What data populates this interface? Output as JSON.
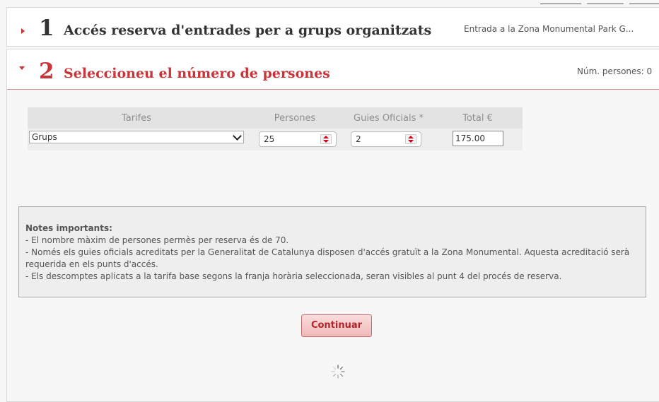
{
  "step1": {
    "number": "1",
    "title": "Accés reserva d'entrades per a grups organitzats",
    "summary": "Entrada a la Zona Monumental Park G..."
  },
  "step2": {
    "number": "2",
    "title": "Seleccioneu el número de persones",
    "summary": "Núm. persones: 0"
  },
  "table": {
    "headers": [
      "Tarifes",
      "Persones",
      "Guies Oficials *",
      "Total €"
    ],
    "rate_selected": "Grups",
    "persons_value": "25",
    "guides_value": "2",
    "total_value": "175.00"
  },
  "notes": {
    "title": "Notes importants:",
    "lines": [
      "- El nombre màxim de persones permès per reserva és de 70.",
      "- Només els guies oficials acreditats per la Generalitat de Catalunya disposen d'accés gratuït a la Zona Monumental. Aquesta acreditació serà requerida en els punts d'accés.",
      "- Els descomptes aplicats a la tarifa base segons la franja horària seleccionada, seran visibles al punt 4 del procés de reserva."
    ]
  },
  "continue_label": "Continuar",
  "icons": {
    "step1_arrow": "caret-right-icon",
    "step2_arrow": "caret-down-icon",
    "select_chevron": "chevron-down-icon",
    "spinner": "spin-arrows-icon",
    "loader": "loading-spinner-icon"
  },
  "colors": {
    "accent": "#c8363a",
    "step1_title": "#333333",
    "button_bg": "#f0b9b9",
    "spinner_arrows": "#d0021b"
  }
}
